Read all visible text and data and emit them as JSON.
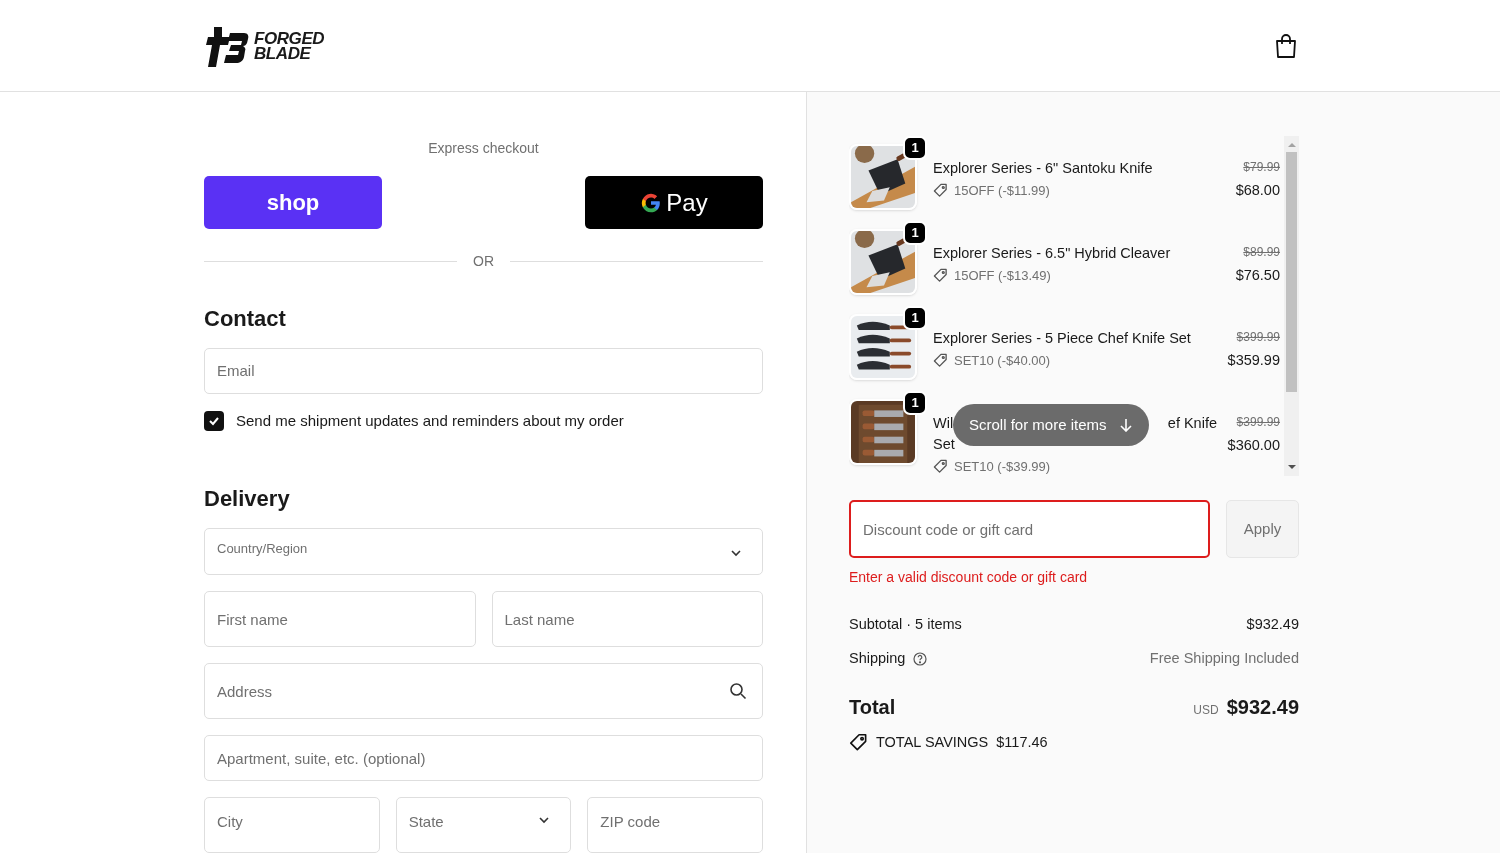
{
  "header": {
    "brand_line_1": "FORGED",
    "brand_line_2": "BLADE"
  },
  "express": {
    "title": "Express checkout",
    "shop_label": "shop",
    "gpay_label": "Pay",
    "divider": "OR"
  },
  "contact": {
    "heading": "Contact",
    "email": {
      "placeholder": "Email"
    },
    "updates": {
      "label": "Send me shipment updates and reminders about my order",
      "checked": true
    }
  },
  "delivery": {
    "heading": "Delivery",
    "country": {
      "label": "Country/Region"
    },
    "first_name": {
      "placeholder": "First name"
    },
    "last_name": {
      "placeholder": "Last name"
    },
    "address": {
      "placeholder": "Address"
    },
    "apartment": {
      "placeholder": "Apartment, suite, etc. (optional)"
    },
    "city": {
      "placeholder": "City"
    },
    "state": {
      "placeholder": "State"
    },
    "zip": {
      "placeholder": "ZIP code"
    }
  },
  "cart": {
    "items": [
      {
        "quantity": "1",
        "name_lines": [
          [
            "Explorer Series - 6\" Santoku Knife"
          ]
        ],
        "discount": "15OFF (-$11.99)",
        "original_price": "$79.99",
        "price": "$68.00"
      },
      {
        "quantity": "1",
        "name_lines": [
          [
            "Explorer Series - 6.5\" Hybrid Cleaver"
          ]
        ],
        "discount": "15OFF (-$13.49)",
        "original_price": "$89.99",
        "price": "$76.50"
      },
      {
        "quantity": "1",
        "name_lines": [
          [
            "Explorer Series - 5 Piece Chef Knife Set"
          ]
        ],
        "discount": "SET10 (-$40.00)",
        "original_price": "$399.99",
        "price": "$359.99"
      },
      {
        "quantity": "1",
        "name_lines": [
          [
            "Wil",
            "ef Knife"
          ],
          [
            "Set"
          ]
        ],
        "discount": "SET10 (-$39.99)",
        "original_price": "$399.99",
        "price": "$360.00"
      }
    ],
    "scroll_hint": "Scroll for more items",
    "discount_field": {
      "placeholder": "Discount code or gift card",
      "error": true
    },
    "apply_button": {
      "label": "Apply",
      "disabled": true
    },
    "error_message": "Enter a valid discount code or gift card",
    "subtotal": {
      "label": "Subtotal · 5 items",
      "value": "$932.49"
    },
    "shipping": {
      "label": "Shipping",
      "value": "Free Shipping Included"
    },
    "total": {
      "label": "Total",
      "currency": "USD",
      "value": "$932.49"
    },
    "savings": {
      "label": "TOTAL SAVINGS",
      "value": "$117.46"
    }
  }
}
